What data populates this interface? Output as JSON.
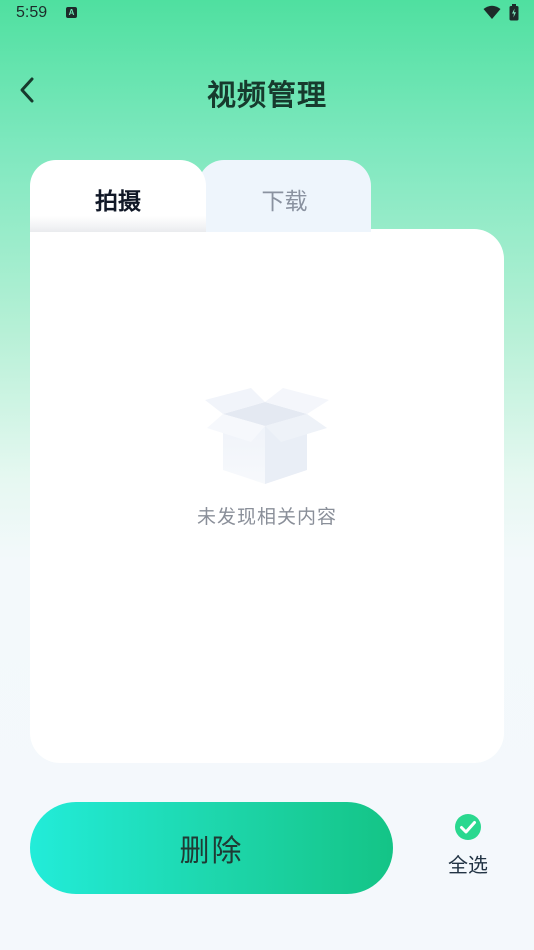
{
  "status_bar": {
    "time": "5:59",
    "notification_letter": "A"
  },
  "header": {
    "title": "视频管理",
    "back_icon": "chevron-left-icon"
  },
  "tabs": [
    {
      "label": "拍摄",
      "active": true
    },
    {
      "label": "下载",
      "active": false
    }
  ],
  "content": {
    "empty_text": "未发现相关内容",
    "empty_icon": "open-box-icon"
  },
  "footer": {
    "delete_label": "删除",
    "select_all_label": "全选",
    "select_all_checked": true
  },
  "colors": {
    "accent": "#2ad88f",
    "delete_gradient_start": "#22ecd9",
    "delete_gradient_end": "#14c486",
    "title": "#173a2d"
  }
}
